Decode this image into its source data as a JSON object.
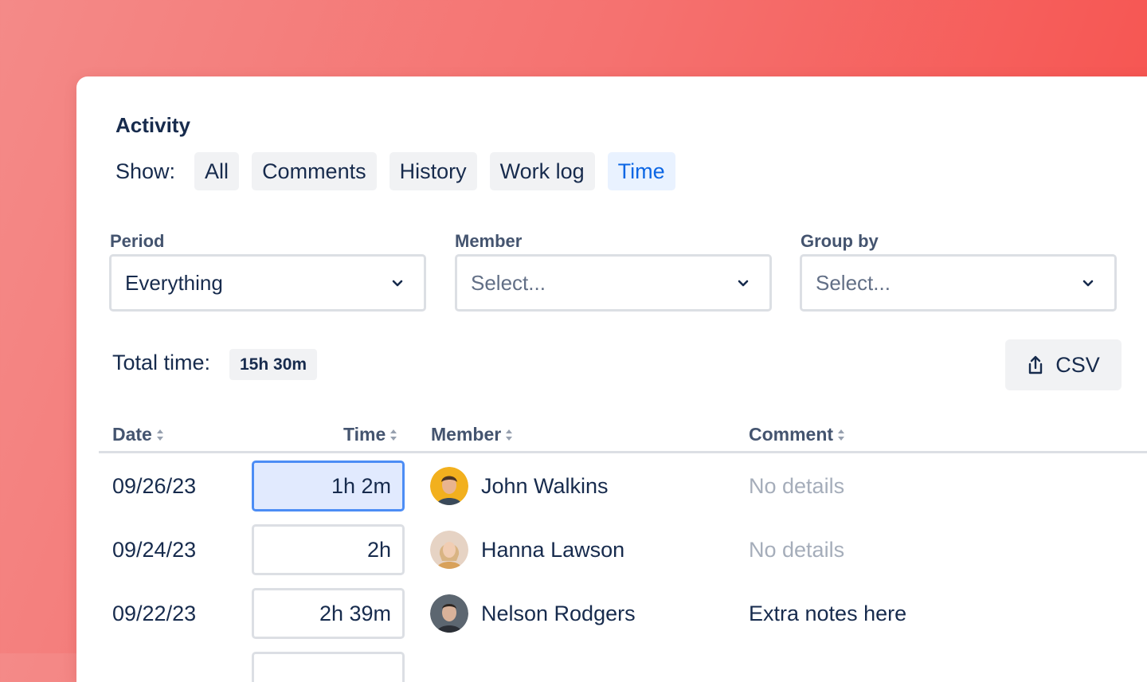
{
  "activity": {
    "title": "Activity",
    "show_label": "Show:",
    "filters": [
      {
        "label": "All",
        "active": false
      },
      {
        "label": "Comments",
        "active": false
      },
      {
        "label": "History",
        "active": false
      },
      {
        "label": "Work log",
        "active": false
      },
      {
        "label": "Time",
        "active": true
      }
    ]
  },
  "fields": {
    "period": {
      "label": "Period",
      "value": "Everything"
    },
    "member": {
      "label": "Member",
      "placeholder": "Select..."
    },
    "group_by": {
      "label": "Group by",
      "placeholder": "Select..."
    }
  },
  "total": {
    "label": "Total time:",
    "value": "15h 30m"
  },
  "export": {
    "label": "CSV",
    "icon": "share-icon"
  },
  "table": {
    "columns": [
      "Date",
      "Time",
      "Member",
      "Comment"
    ],
    "rows": [
      {
        "date": "09/26/23",
        "time": "1h 2m",
        "member": "John Walkins",
        "comment": "No details",
        "comment_muted": true,
        "focused": true
      },
      {
        "date": "09/24/23",
        "time": "2h",
        "member": "Hanna Lawson",
        "comment": "No details",
        "comment_muted": true,
        "focused": false
      },
      {
        "date": "09/22/23",
        "time": "2h 39m",
        "member": "Nelson Rodgers",
        "comment": "Extra notes here",
        "comment_muted": false,
        "focused": false
      }
    ]
  },
  "colors": {
    "accent": "#0c66e4",
    "annotation_arrow": "#f56d6b",
    "focus_border": "#4c8df5"
  }
}
